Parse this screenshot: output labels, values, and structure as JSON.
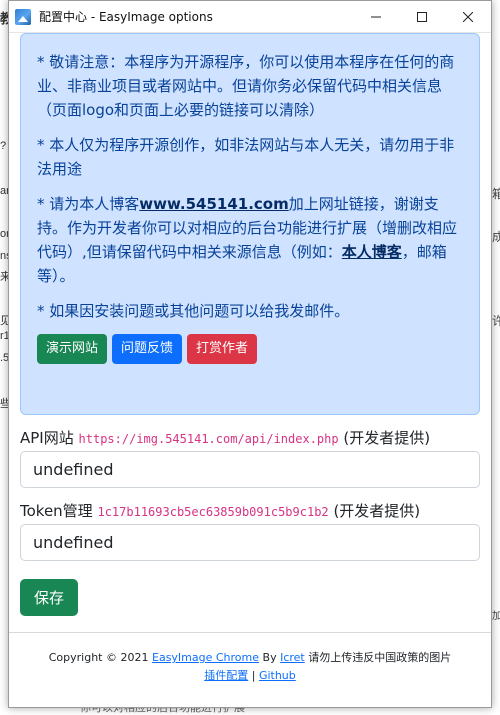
{
  "window": {
    "title": "配置中心 - EasyImage options"
  },
  "notice": {
    "p1": "* 敬请注意：本程序为开源程序，你可以使用本程序在任何的商业、非商业项目或者网站中。但请你务必保留代码中相关信息（页面logo和页面上必要的链接可以清除）",
    "p2": "* 本人仅为程序开源创作，如非法网站与本人无关，请勿用于非法用途",
    "p3_pre": "* 请为本人博客",
    "p3_link": "www.545141.com",
    "p3_mid": "加上网址链接，谢谢支持。作为开发者你可以对相应的后台功能进行扩展（增删改相应代码）,但请保留代码中相关来源信息（例如：",
    "p3_link2": "本人博客",
    "p3_post": "，邮箱等）。",
    "p4": "* 如果因安装问题或其他问题可以给我发邮件。",
    "buttons": {
      "demo": "演示网站",
      "feedback": "问题反馈",
      "donate": "打赏作者"
    }
  },
  "api": {
    "label": "API网站",
    "url": "https://img.545141.com/api/index.php",
    "suffix": "(开发者提供)",
    "value": "undefined"
  },
  "token": {
    "label": "Token管理",
    "code": "1c17b11693cb5ec63859b091c5b9c1b2",
    "suffix": "(开发者提供)",
    "value": "undefined"
  },
  "save_label": "保存",
  "footer": {
    "copyright": "Copyright © 2021",
    "product_link": "EasyImage Chrome",
    "by": "By",
    "author_link": "Icret",
    "warning": "请勿上传违反中国政策的图片",
    "config_link": "插件配置",
    "sep": "|",
    "github_link": "Github"
  },
  "background": {
    "left_fragments": [
      "教",
      "?",
      "ar",
      "on",
      "ns",
      "来",
      "见",
      "r1",
      ".5",
      "些"
    ],
    "right_fragments": [
      "箱",
      "成",
      "许",
      "加"
    ],
    "bottom_text": "你可以对相应的后台功能进行扩展"
  }
}
